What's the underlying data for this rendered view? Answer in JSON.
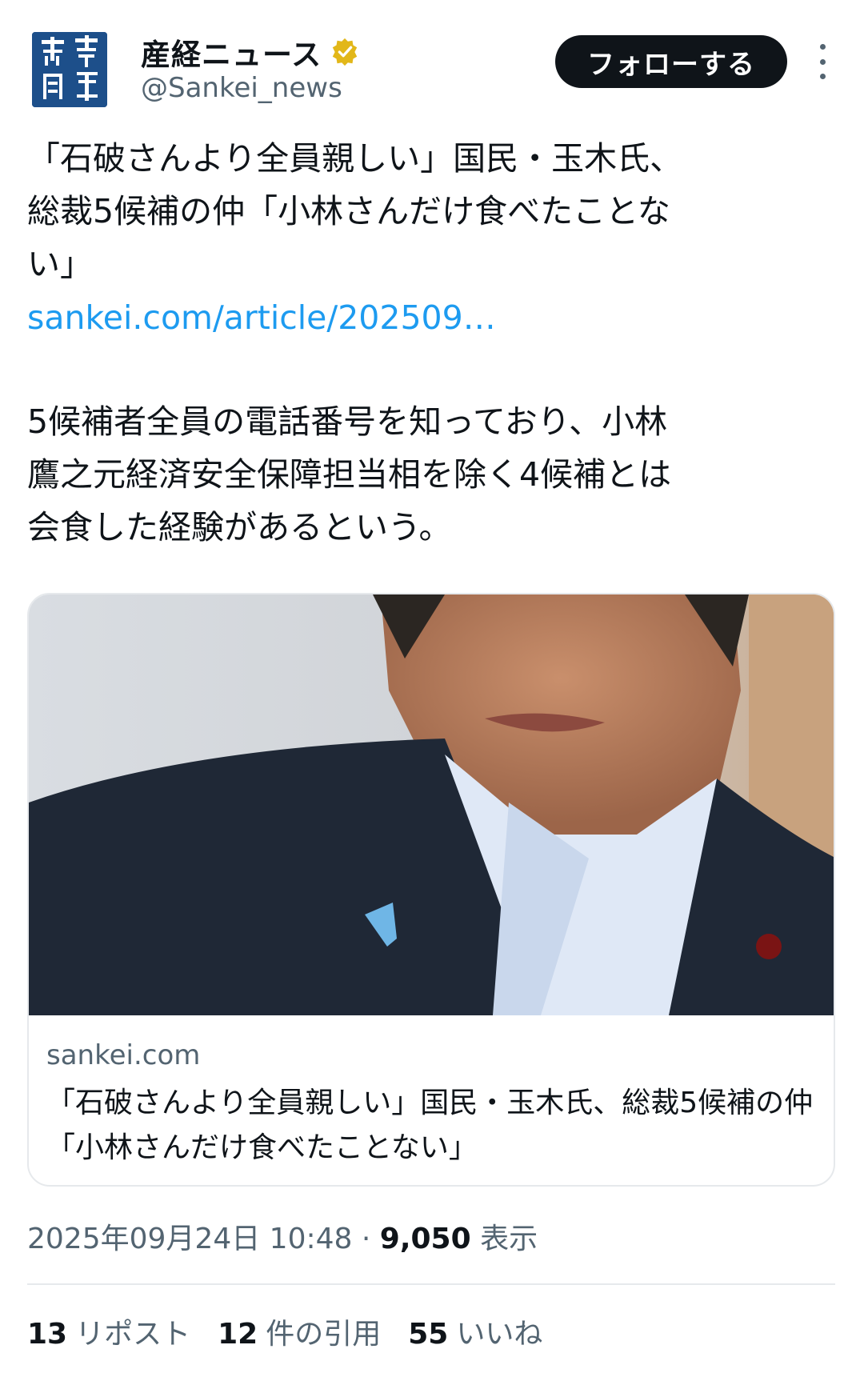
{
  "account": {
    "logo_text": "産經新聞",
    "name": "産経ニュース",
    "handle": "@Sankei_news",
    "verified_icon": "verified-badge-icon",
    "follow_label": "フォローする",
    "more_icon": "more-vertical-icon"
  },
  "tweet": {
    "headline": "「石破さんより全員親しい」国民・玉木氏、\n総裁5候補の仲「小林さんだけ食べたことな\nい」",
    "link": "sankei.com/article/202509…",
    "body": "5候補者全員の電話番号を知っており、小林\n鷹之元経済安全保障担当相を除く4候補とは\n会食した経験があるという。"
  },
  "card": {
    "domain": "sankei.com",
    "title": "「石破さんより全員親しい」国民・玉木氏、総裁5候補の仲「小林さんだけ食べたことない」"
  },
  "meta": {
    "datetime": "2025年09月24日 10:48",
    "separator": " · ",
    "views_count": "9,050",
    "views_label": "表示"
  },
  "stats": {
    "reposts_count": "13",
    "reposts_label": "リポスト",
    "quotes_count": "12",
    "quotes_label": "件の引用",
    "likes_count": "55",
    "likes_label": "いいね"
  },
  "colors": {
    "link": "#1d9bf0",
    "secondary_text": "#536471",
    "primary_text": "#0f1419",
    "verified_badge": "#e2b719",
    "logo_bg": "#1d4f8a"
  }
}
